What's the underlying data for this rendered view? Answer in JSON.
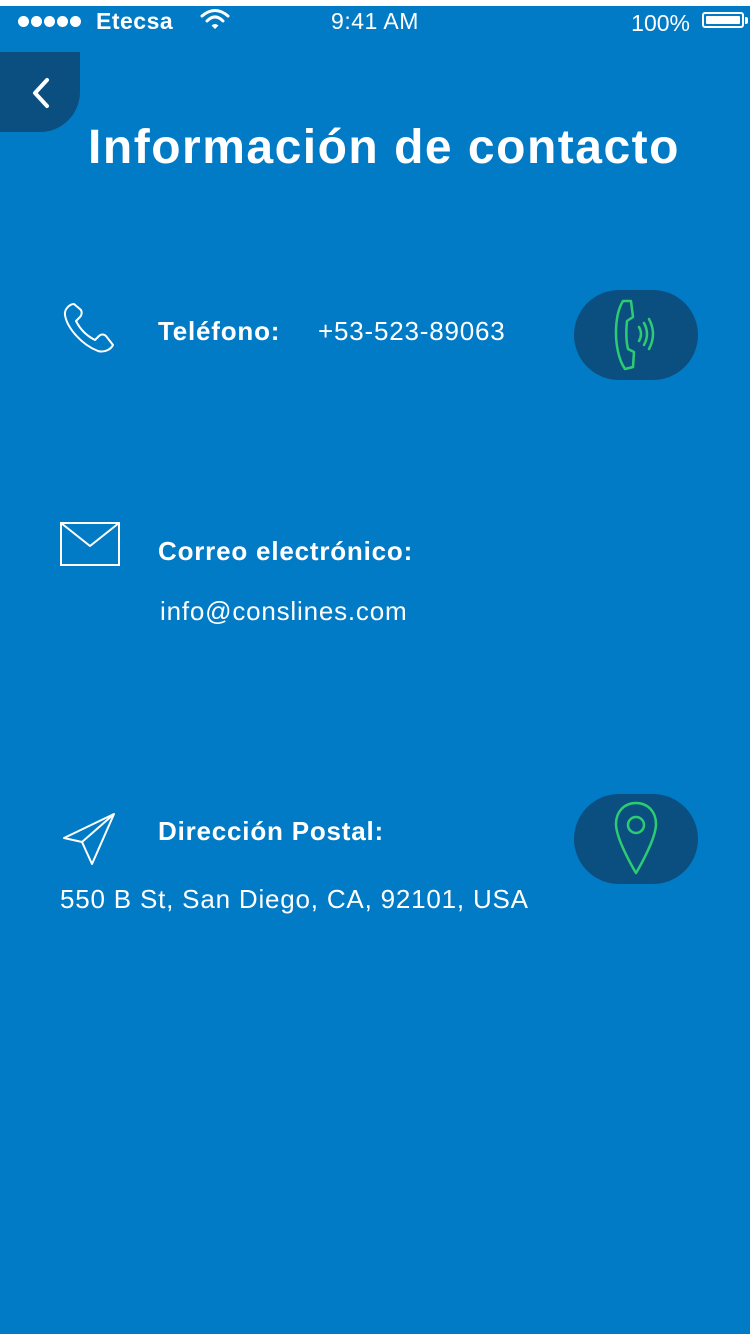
{
  "status_bar": {
    "carrier": "Etecsa",
    "time": "9:41 AM",
    "battery": "100%",
    "signal_bars": 5
  },
  "header": {
    "title": "Información de contacto"
  },
  "contact": {
    "phone": {
      "label": "Teléfono:",
      "value": "+53-523-89063",
      "icon": "phone-icon",
      "action_icon": "phone-ringing-icon"
    },
    "email": {
      "label": "Correo electrónico:",
      "value": "info@conslines.com",
      "icon": "envelope-icon"
    },
    "postal": {
      "label": "Dirección Postal:",
      "value": "550 B St, San Diego, CA, 92101, USA",
      "icon": "paper-plane-icon",
      "action_icon": "location-pin-icon"
    }
  },
  "colors": {
    "background": "#027BC6",
    "button_bg": "#0B4F80",
    "accent_green": "#2ECC71",
    "text": "#FFFFFF"
  }
}
